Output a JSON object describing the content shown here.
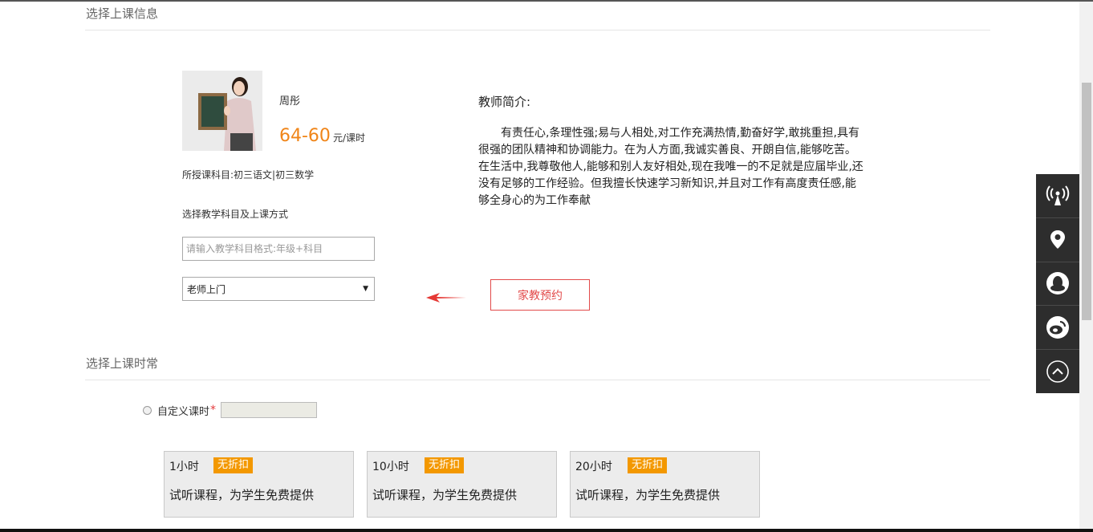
{
  "sections": {
    "class_info_title": "选择上课信息",
    "class_hours_title": "选择上课时常"
  },
  "teacher": {
    "name": "周彤",
    "price": "64-60",
    "price_unit": "元/课时",
    "subjects": "所授课科目:初三语文|初三数学",
    "choose_label": "选择教学科目及上课方式",
    "subject_input_placeholder": "请输入教学科目格式:年级+科目",
    "mode_selected": "老师上门",
    "book_button": "家教预约"
  },
  "intro": {
    "title": "教师简介:",
    "text": "有责任心,条理性强;易与人相处,对工作充满热情,勤奋好学,敢挑重担,具有很强的团队精神和协调能力。在为人方面,我诚实善良、开朗自信,能够吃苦。在生活中,我尊敬他人,能够和别人友好相处,现在我唯一的不足就是应届毕业,还没有足够的工作经验。但我擅长快速学习新知识,并且对工作有高度责任感,能够全身心的为工作奉献"
  },
  "custom_hours": {
    "label": "自定义课时",
    "required_mark": "*"
  },
  "packages": [
    {
      "hours": "1小时",
      "badge": "无折扣",
      "desc": "试听课程，为学生免费提供"
    },
    {
      "hours": "10小时",
      "badge": "无折扣",
      "desc": "试听课程，为学生免费提供"
    },
    {
      "hours": "20小时",
      "badge": "无折扣",
      "desc": "试听课程，为学生免费提供"
    }
  ],
  "side_toolbar": [
    "broadcast-icon",
    "location-pin-icon",
    "qq-penguin-icon",
    "weibo-icon",
    "back-to-top-icon"
  ],
  "colors": {
    "accent_orange": "#f08519",
    "badge_orange": "#f39800",
    "book_red": "#e24a4a",
    "toolbar_bg": "#2d2d2d"
  }
}
